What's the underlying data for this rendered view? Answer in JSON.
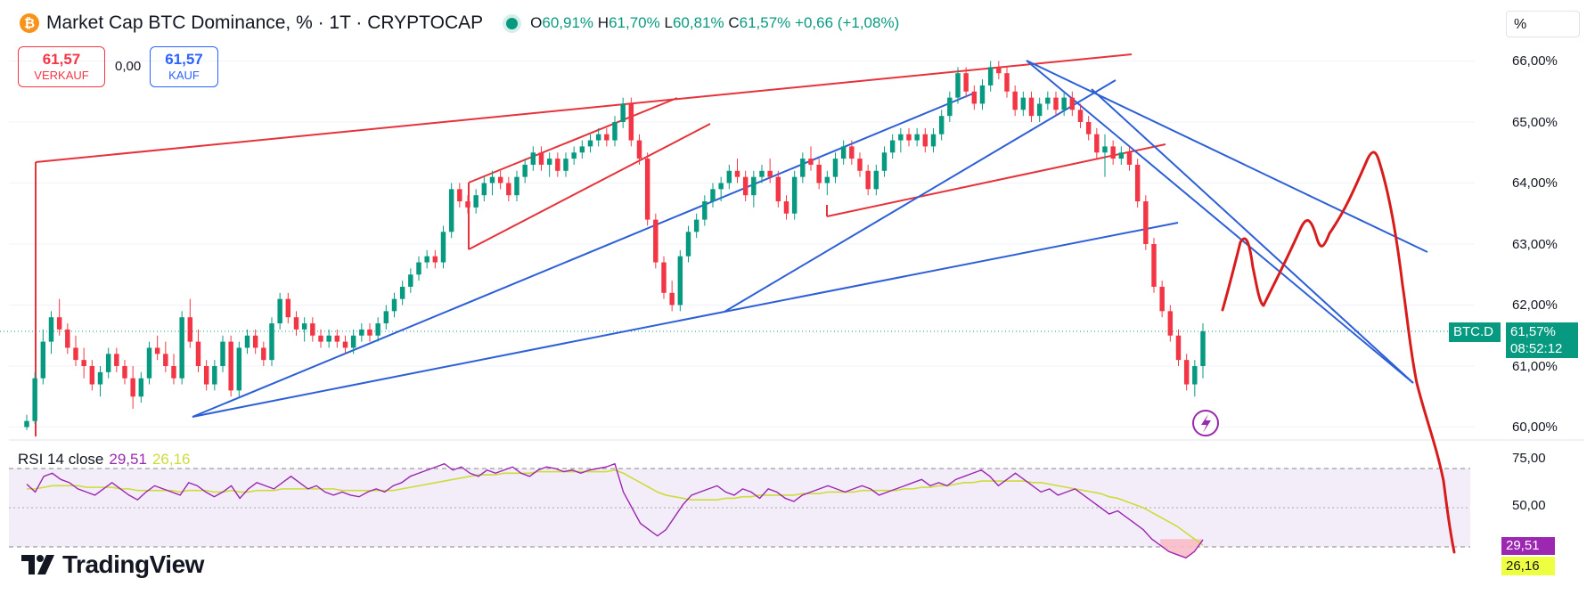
{
  "header": {
    "coin_glyph": "₿",
    "title": "Market Cap BTC Dominance, % · 1T · CRYPTOCAP",
    "ohlc": {
      "o_key": "O",
      "o": "60,91%",
      "h_key": "H",
      "h": "61,70%",
      "l_key": "L",
      "l": "60,81%",
      "c_key": "C",
      "c": "61,57%",
      "change": "+0,66 (+1,08%)"
    }
  },
  "trade": {
    "sell_value": "61,57",
    "sell_label": "VERKAUF",
    "spread": "0,00",
    "buy_value": "61,57",
    "buy_label": "KAUF"
  },
  "unit_selector": "%",
  "price_scale": [
    "66,00%",
    "65,00%",
    "64,00%",
    "63,00%",
    "62,00%",
    "61,00%",
    "60,00%"
  ],
  "price_scale_values": [
    66,
    65,
    64,
    63,
    62,
    61,
    60
  ],
  "current": {
    "symbol": "BTC.D",
    "price": "61,57%",
    "countdown": "08:52:12",
    "value": 61.57
  },
  "rsi": {
    "label": "RSI 14 close",
    "value": "29,51",
    "ma_value": "26,16",
    "scale": [
      "75,00",
      "50,00"
    ]
  },
  "branding": {
    "name": "TradingView"
  },
  "colors": {
    "up": "#089981",
    "down": "#f23645",
    "rsi": "#9c27b0",
    "rsi_ma": "#cddc39",
    "trend_red": "#e5323b",
    "trend_blue": "#2d5fd6",
    "drawing": "#d81c1c"
  },
  "chart_data": [
    {
      "type": "candlestick",
      "title": "Market Cap BTC Dominance, % · 1T · CRYPTOCAP",
      "ylabel": "%",
      "ylim": [
        59.85,
        66.45
      ],
      "y_ticks": [
        60,
        61,
        62,
        63,
        64,
        65,
        66
      ],
      "grid": true,
      "ohlc": [
        [
          60.0,
          60.2,
          59.95,
          60.1
        ],
        [
          60.1,
          60.9,
          60.05,
          60.8
        ],
        [
          60.8,
          61.6,
          60.7,
          61.4
        ],
        [
          61.4,
          61.9,
          61.2,
          61.8
        ],
        [
          61.8,
          62.1,
          61.5,
          61.6
        ],
        [
          61.6,
          61.7,
          61.2,
          61.3
        ],
        [
          61.3,
          61.5,
          61.0,
          61.1
        ],
        [
          61.1,
          61.3,
          60.8,
          61.0
        ],
        [
          61.0,
          61.1,
          60.6,
          60.7
        ],
        [
          60.7,
          61.0,
          60.5,
          60.9
        ],
        [
          60.9,
          61.3,
          60.8,
          61.2
        ],
        [
          61.2,
          61.3,
          60.9,
          61.0
        ],
        [
          61.0,
          61.1,
          60.7,
          60.8
        ],
        [
          60.8,
          61.0,
          60.3,
          60.5
        ],
        [
          60.5,
          60.9,
          60.4,
          60.8
        ],
        [
          60.8,
          61.4,
          60.7,
          61.3
        ],
        [
          61.3,
          61.5,
          61.1,
          61.2
        ],
        [
          61.2,
          61.4,
          60.9,
          61.0
        ],
        [
          61.0,
          61.2,
          60.7,
          60.8
        ],
        [
          60.8,
          61.9,
          60.7,
          61.8
        ],
        [
          61.8,
          62.1,
          61.3,
          61.4
        ],
        [
          61.4,
          61.6,
          60.9,
          61.0
        ],
        [
          61.0,
          61.1,
          60.6,
          60.7
        ],
        [
          60.7,
          61.1,
          60.6,
          61.0
        ],
        [
          61.0,
          61.5,
          60.9,
          61.4
        ],
        [
          61.4,
          61.5,
          60.5,
          60.6
        ],
        [
          60.6,
          61.4,
          60.5,
          61.3
        ],
        [
          61.3,
          61.6,
          61.2,
          61.5
        ],
        [
          61.5,
          61.6,
          61.2,
          61.3
        ],
        [
          61.3,
          61.4,
          61.0,
          61.1
        ],
        [
          61.1,
          61.8,
          61.0,
          61.7
        ],
        [
          61.7,
          62.2,
          61.6,
          62.1
        ],
        [
          62.1,
          62.2,
          61.7,
          61.8
        ],
        [
          61.8,
          61.9,
          61.5,
          61.6
        ],
        [
          61.6,
          61.8,
          61.4,
          61.7
        ],
        [
          61.7,
          61.8,
          61.4,
          61.5
        ],
        [
          61.5,
          61.6,
          61.3,
          61.4
        ],
        [
          61.4,
          61.6,
          61.3,
          61.5
        ],
        [
          61.5,
          61.6,
          61.3,
          61.4
        ],
        [
          61.4,
          61.5,
          61.2,
          61.3
        ],
        [
          61.3,
          61.6,
          61.2,
          61.5
        ],
        [
          61.5,
          61.7,
          61.4,
          61.6
        ],
        [
          61.6,
          61.7,
          61.4,
          61.5
        ],
        [
          61.5,
          61.8,
          61.4,
          61.7
        ],
        [
          61.7,
          62.0,
          61.6,
          61.9
        ],
        [
          61.9,
          62.2,
          61.8,
          62.1
        ],
        [
          62.1,
          62.4,
          62.0,
          62.3
        ],
        [
          62.3,
          62.6,
          62.2,
          62.5
        ],
        [
          62.5,
          62.8,
          62.4,
          62.7
        ],
        [
          62.7,
          62.9,
          62.6,
          62.8
        ],
        [
          62.8,
          62.9,
          62.6,
          62.7
        ],
        [
          62.7,
          63.3,
          62.6,
          63.2
        ],
        [
          63.2,
          64.0,
          63.1,
          63.9
        ],
        [
          63.9,
          64.0,
          63.6,
          63.7
        ],
        [
          63.7,
          63.8,
          63.5,
          63.6
        ],
        [
          63.6,
          63.9,
          63.5,
          63.8
        ],
        [
          63.8,
          64.1,
          63.7,
          64.0
        ],
        [
          64.0,
          64.2,
          63.8,
          64.1
        ],
        [
          64.1,
          64.2,
          63.9,
          64.0
        ],
        [
          64.0,
          64.1,
          63.7,
          63.8
        ],
        [
          63.8,
          64.2,
          63.7,
          64.1
        ],
        [
          64.1,
          64.4,
          64.0,
          64.3
        ],
        [
          64.3,
          64.6,
          64.2,
          64.5
        ],
        [
          64.5,
          64.6,
          64.2,
          64.3
        ],
        [
          64.3,
          64.5,
          64.1,
          64.4
        ],
        [
          64.4,
          64.5,
          64.1,
          64.2
        ],
        [
          64.2,
          64.5,
          64.1,
          64.4
        ],
        [
          64.4,
          64.6,
          64.3,
          64.5
        ],
        [
          64.5,
          64.7,
          64.4,
          64.6
        ],
        [
          64.6,
          64.8,
          64.5,
          64.7
        ],
        [
          64.7,
          64.9,
          64.6,
          64.8
        ],
        [
          64.8,
          64.9,
          64.6,
          64.7
        ],
        [
          64.7,
          65.1,
          64.6,
          65.0
        ],
        [
          65.0,
          65.4,
          64.9,
          65.3
        ],
        [
          65.3,
          65.4,
          64.6,
          64.7
        ],
        [
          64.7,
          64.8,
          64.3,
          64.4
        ],
        [
          64.4,
          64.5,
          63.3,
          63.4
        ],
        [
          63.4,
          63.5,
          62.6,
          62.7
        ],
        [
          62.7,
          62.8,
          62.1,
          62.2
        ],
        [
          62.2,
          62.4,
          61.9,
          62.0
        ],
        [
          62.0,
          62.9,
          61.9,
          62.8
        ],
        [
          62.8,
          63.3,
          62.7,
          63.2
        ],
        [
          63.2,
          63.5,
          63.1,
          63.4
        ],
        [
          63.4,
          63.8,
          63.3,
          63.7
        ],
        [
          63.7,
          64.0,
          63.6,
          63.9
        ],
        [
          63.9,
          64.1,
          63.7,
          64.0
        ],
        [
          64.0,
          64.3,
          63.9,
          64.2
        ],
        [
          64.2,
          64.4,
          64.0,
          64.1
        ],
        [
          64.1,
          64.2,
          63.7,
          63.8
        ],
        [
          63.8,
          64.2,
          63.6,
          64.1
        ],
        [
          64.1,
          64.3,
          64.0,
          64.2
        ],
        [
          64.2,
          64.4,
          64.0,
          64.1
        ],
        [
          64.1,
          64.2,
          63.6,
          63.7
        ],
        [
          63.7,
          63.8,
          63.4,
          63.5
        ],
        [
          63.5,
          64.2,
          63.4,
          64.1
        ],
        [
          64.1,
          64.5,
          64.0,
          64.4
        ],
        [
          64.4,
          64.6,
          64.2,
          64.3
        ],
        [
          64.3,
          64.4,
          63.9,
          64.0
        ],
        [
          64.0,
          64.2,
          63.8,
          64.1
        ],
        [
          64.1,
          64.5,
          64.0,
          64.4
        ],
        [
          64.4,
          64.7,
          64.3,
          64.6
        ],
        [
          64.6,
          64.7,
          64.3,
          64.4
        ],
        [
          64.4,
          64.5,
          64.1,
          64.2
        ],
        [
          64.2,
          64.3,
          63.8,
          63.9
        ],
        [
          63.9,
          64.3,
          63.8,
          64.2
        ],
        [
          64.2,
          64.6,
          64.1,
          64.5
        ],
        [
          64.5,
          64.8,
          64.4,
          64.7
        ],
        [
          64.7,
          64.9,
          64.5,
          64.8
        ],
        [
          64.8,
          64.9,
          64.6,
          64.7
        ],
        [
          64.7,
          64.9,
          64.6,
          64.8
        ],
        [
          64.8,
          64.9,
          64.5,
          64.6
        ],
        [
          64.6,
          64.9,
          64.5,
          64.8
        ],
        [
          64.8,
          65.2,
          64.7,
          65.1
        ],
        [
          65.1,
          65.5,
          65.0,
          65.4
        ],
        [
          65.4,
          65.9,
          65.3,
          65.8
        ],
        [
          65.8,
          65.9,
          65.4,
          65.5
        ],
        [
          65.5,
          65.6,
          65.2,
          65.3
        ],
        [
          65.3,
          65.7,
          65.2,
          65.6
        ],
        [
          65.6,
          66.0,
          65.5,
          65.9
        ],
        [
          65.9,
          66.0,
          65.7,
          65.8
        ],
        [
          65.8,
          65.9,
          65.4,
          65.5
        ],
        [
          65.5,
          65.6,
          65.1,
          65.2
        ],
        [
          65.2,
          65.5,
          65.1,
          65.4
        ],
        [
          65.4,
          65.5,
          65.0,
          65.1
        ],
        [
          65.1,
          65.4,
          65.0,
          65.3
        ],
        [
          65.3,
          65.5,
          65.2,
          65.4
        ],
        [
          65.4,
          65.5,
          65.1,
          65.2
        ],
        [
          65.2,
          65.5,
          65.1,
          65.4
        ],
        [
          65.4,
          65.5,
          65.1,
          65.2
        ],
        [
          65.2,
          65.3,
          64.9,
          65.0
        ],
        [
          65.0,
          65.1,
          64.7,
          64.8
        ],
        [
          64.8,
          64.9,
          64.4,
          64.5
        ],
        [
          64.5,
          64.8,
          64.1,
          64.6
        ],
        [
          64.6,
          64.7,
          64.3,
          64.4
        ],
        [
          64.4,
          64.6,
          64.3,
          64.5
        ],
        [
          64.5,
          64.6,
          64.2,
          64.3
        ],
        [
          64.3,
          64.4,
          63.6,
          63.7
        ],
        [
          63.7,
          63.8,
          62.9,
          63.0
        ],
        [
          63.0,
          63.1,
          62.2,
          62.3
        ],
        [
          62.3,
          62.4,
          61.8,
          61.9
        ],
        [
          61.9,
          62.0,
          61.4,
          61.5
        ],
        [
          61.5,
          61.6,
          61.0,
          61.1
        ],
        [
          61.1,
          61.2,
          60.6,
          60.7
        ],
        [
          60.7,
          61.1,
          60.5,
          61.0
        ],
        [
          61.0,
          61.7,
          60.8,
          61.57
        ]
      ]
    },
    {
      "type": "line",
      "title": "RSI 14 close",
      "ylim": [
        15,
        90
      ],
      "y_ticks": [
        75,
        50
      ],
      "series": [
        {
          "name": "RSI 14 close",
          "values": [
            65,
            60,
            70,
            72,
            68,
            66,
            62,
            60,
            58,
            62,
            66,
            62,
            58,
            55,
            60,
            64,
            62,
            60,
            58,
            66,
            64,
            60,
            57,
            60,
            64,
            56,
            62,
            66,
            64,
            62,
            66,
            70,
            66,
            62,
            64,
            60,
            58,
            60,
            58,
            57,
            60,
            62,
            60,
            64,
            66,
            70,
            72,
            74,
            76,
            78,
            74,
            76,
            72,
            70,
            74,
            72,
            74,
            76,
            72,
            70,
            74,
            76,
            75,
            73,
            74,
            72,
            74,
            75,
            76,
            78,
            60,
            50,
            40,
            36,
            32,
            36,
            44,
            52,
            58,
            60,
            62,
            64,
            60,
            58,
            62,
            60,
            56,
            62,
            60,
            56,
            54,
            58,
            60,
            62,
            64,
            62,
            60,
            62,
            64,
            62,
            58,
            60,
            62,
            64,
            66,
            68,
            64,
            66,
            64,
            68,
            70,
            72,
            74,
            70,
            64,
            68,
            72,
            68,
            64,
            60,
            62,
            58,
            60,
            62,
            58,
            54,
            50,
            46,
            48,
            44,
            40,
            36,
            30,
            26,
            22,
            20,
            18,
            22,
            29.51
          ]
        },
        {
          "name": "MA",
          "values": [
            62,
            62,
            63,
            64,
            64,
            64,
            64,
            63,
            63,
            63,
            63,
            62,
            62,
            61,
            61,
            61,
            61,
            61,
            60,
            61,
            61,
            61,
            60,
            60,
            61,
            60,
            60,
            61,
            61,
            61,
            62,
            62,
            62,
            62,
            62,
            62,
            62,
            61,
            61,
            61,
            61,
            61,
            61,
            61,
            62,
            63,
            64,
            65,
            66,
            67,
            68,
            69,
            70,
            71,
            71,
            71,
            72,
            72,
            72,
            72,
            73,
            73,
            73,
            73,
            73,
            73,
            73,
            73,
            73,
            74,
            72,
            69,
            66,
            63,
            60,
            58,
            57,
            56,
            55,
            55,
            55,
            55,
            56,
            56,
            57,
            57,
            58,
            58,
            58,
            58,
            58,
            59,
            59,
            59,
            60,
            60,
            60,
            60,
            61,
            61,
            61,
            61,
            61,
            62,
            62,
            63,
            63,
            64,
            64,
            65,
            66,
            66,
            67,
            67,
            67,
            67,
            67,
            67,
            66,
            66,
            65,
            64,
            63,
            62,
            61,
            60,
            59,
            57,
            56,
            54,
            52,
            50,
            47,
            44,
            41,
            38,
            34,
            30,
            26.16
          ]
        }
      ]
    }
  ]
}
